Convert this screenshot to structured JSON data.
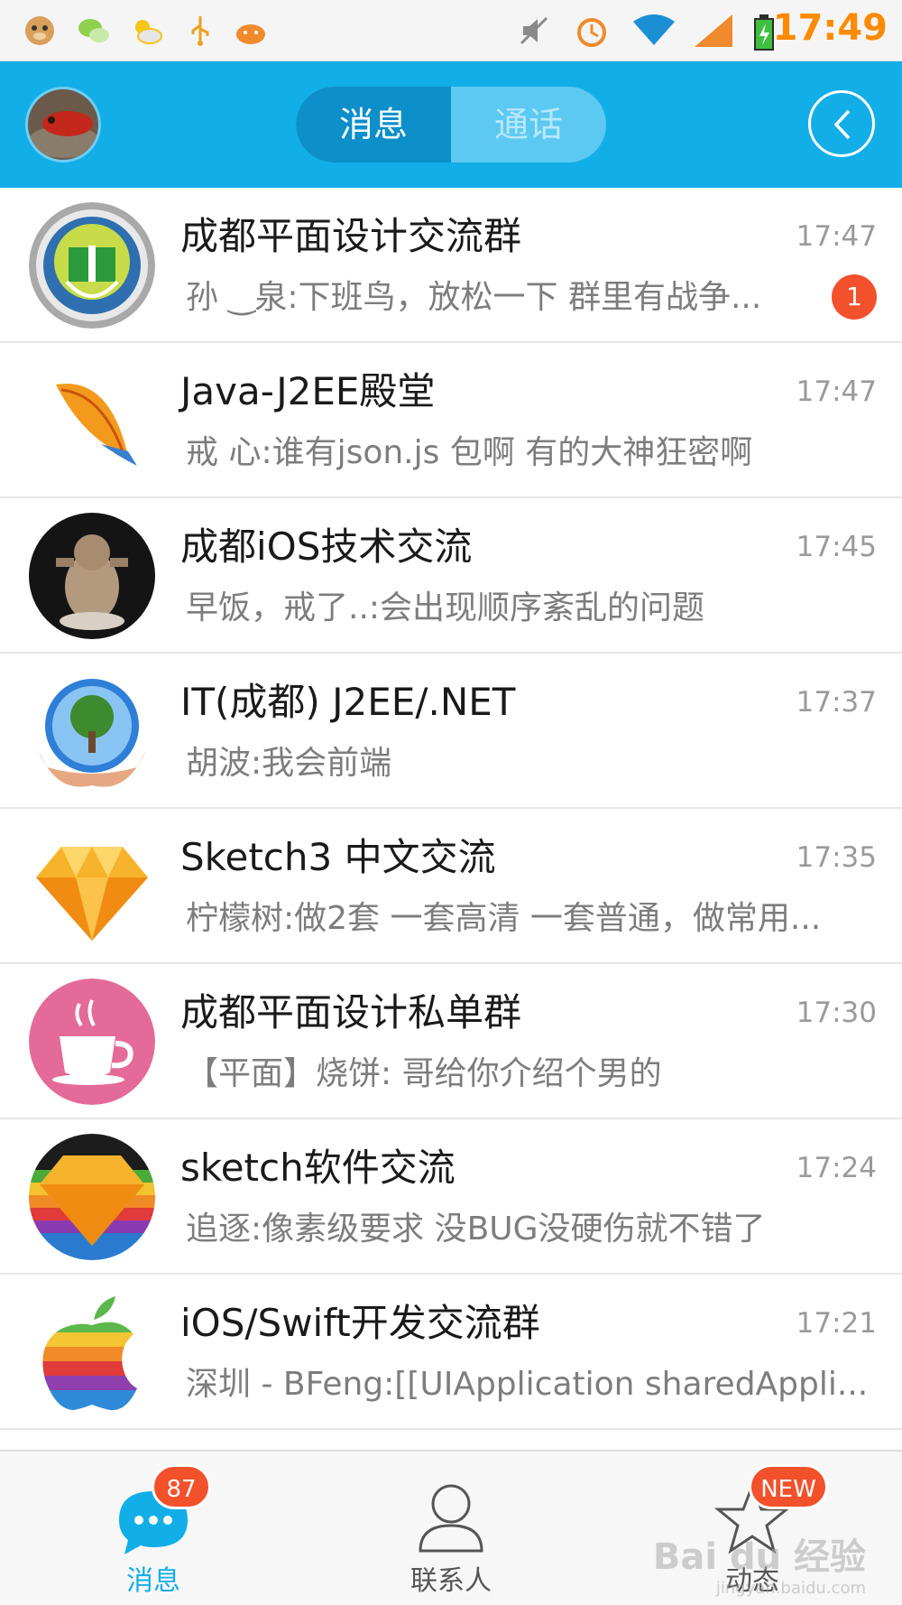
{
  "status_bar": {
    "time": "17:49",
    "left_icons": [
      "monkey-app-icon",
      "wechat-icon",
      "weather-icon",
      "usb-icon",
      "android-debug-icon"
    ],
    "right_icons": [
      "mute-icon",
      "alarm-icon",
      "wifi-icon",
      "signal-icon",
      "battery-charging-icon"
    ],
    "time_color": "#ff8a00"
  },
  "header": {
    "tabs": [
      {
        "label": "消息",
        "active": true
      },
      {
        "label": "通话",
        "active": false
      }
    ],
    "bg_color": "#12aee8"
  },
  "conversations": [
    {
      "title": "成都平面设计交流群",
      "time": "17:47",
      "message": "孙 ‿泉:下班鸟，放松一下   群里有战争...",
      "unread": "1",
      "avatar_icon": "book-logo-icon"
    },
    {
      "title": "Java-J2EE殿堂",
      "time": "17:47",
      "message": "戒 心:谁有json.js 包啊 有的大神狂密啊",
      "avatar_icon": "feather-icon"
    },
    {
      "title": "成都iOS技术交流",
      "time": "17:45",
      "message": "早饭，戒了..:会出现顺序紊乱的问题",
      "avatar_icon": "baby-photo-icon"
    },
    {
      "title": "IT(成都) J2EE/.NET",
      "time": "17:37",
      "message": "胡波:我会前端",
      "avatar_icon": "globe-tree-icon"
    },
    {
      "title": "Sketch3 中文交流",
      "time": "17:35",
      "message": "柠檬树:做2套 一套高清 一套普通，做常用...",
      "avatar_icon": "sketch-diamond-icon"
    },
    {
      "title": "成都平面设计私单群",
      "time": "17:30",
      "message": "【平面】烧饼:     哥给你介绍个男的",
      "avatar_icon": "coffee-cup-icon"
    },
    {
      "title": "sketch软件交流",
      "time": "17:24",
      "message": "追逐:像素级要求 没BUG没硬伤就不错了",
      "avatar_icon": "sketch-rainbow-icon"
    },
    {
      "title": "iOS/Swift开发交流群",
      "time": "17:21",
      "message": "深圳 - BFeng:[[UIApplication sharedAppli...",
      "avatar_icon": "rainbow-apple-icon"
    }
  ],
  "bottom_nav": {
    "items": [
      {
        "label": "消息",
        "badge": "87",
        "icon": "chat-bubble-icon",
        "active": true
      },
      {
        "label": "联系人",
        "icon": "contact-person-icon",
        "active": false
      },
      {
        "label": "动态",
        "badge": "NEW",
        "icon": "star-icon",
        "active": false
      }
    ],
    "active_color": "#12aee8",
    "inactive_color": "#555555"
  },
  "watermark": {
    "main": "Bai du 经验",
    "sub": "jingyan.baidu.com"
  }
}
